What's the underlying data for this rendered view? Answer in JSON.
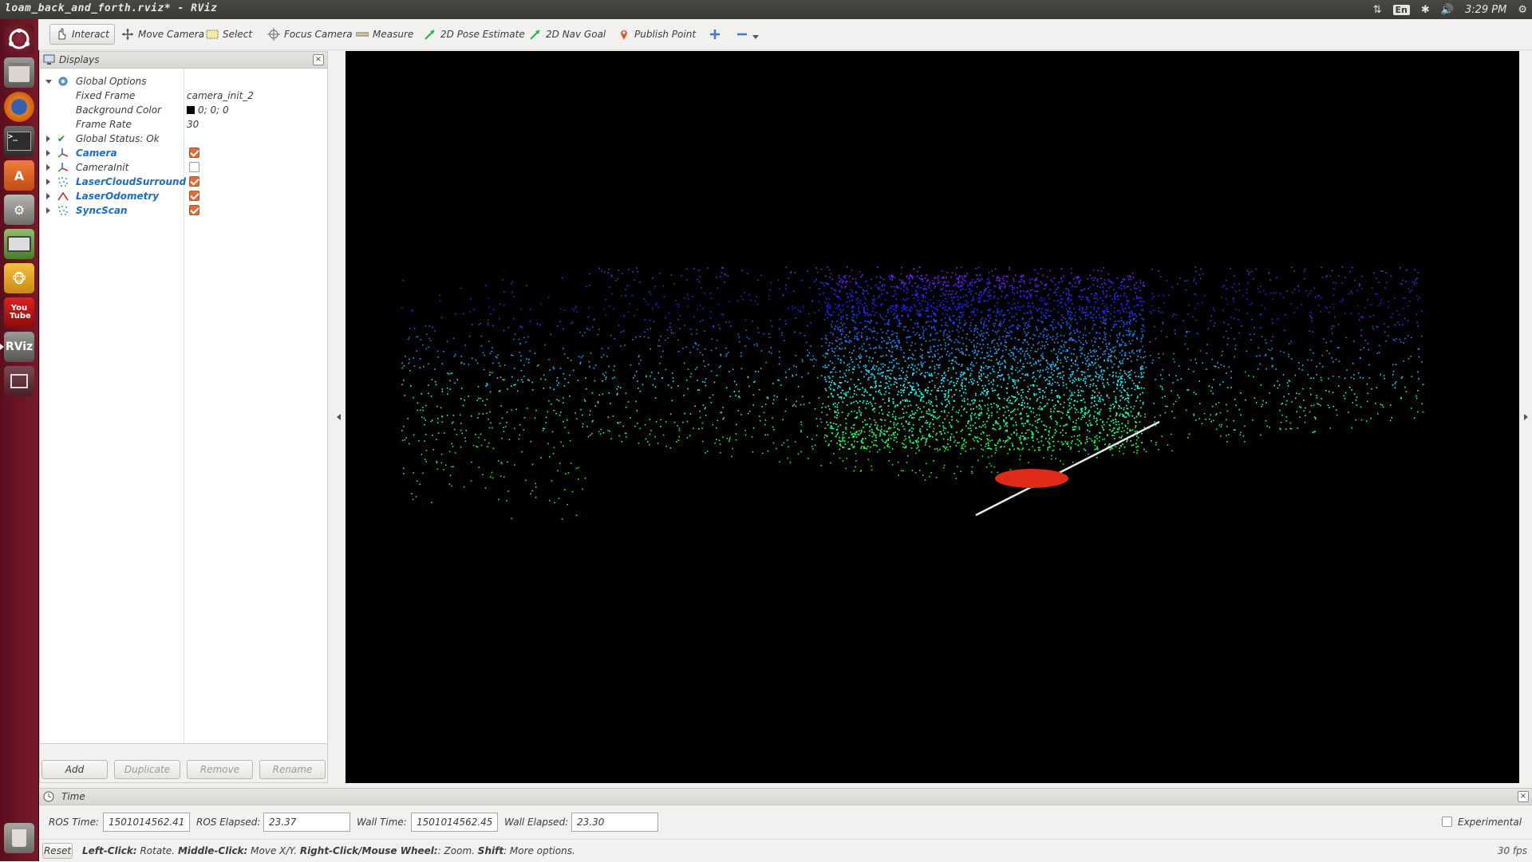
{
  "window": {
    "title": "loam_back_and_forth.rviz* - RViz"
  },
  "tray": {
    "language": "En",
    "clock": "3:29 PM"
  },
  "launcher": {
    "rviz_label": "RViz",
    "youtube_label": "You Tube"
  },
  "toolbar": {
    "interact": "Interact",
    "move_camera": "Move Camera",
    "select": "Select",
    "focus_camera": "Focus Camera",
    "measure": "Measure",
    "pose_estimate": "2D Pose Estimate",
    "nav_goal": "2D Nav Goal",
    "publish_point": "Publish Point"
  },
  "displays": {
    "title": "Displays",
    "global_options": "Global Options",
    "fixed_frame_label": "Fixed Frame",
    "fixed_frame_value": "camera_init_2",
    "background_color_label": "Background Color",
    "background_color_value": "0; 0; 0",
    "frame_rate_label": "Frame Rate",
    "frame_rate_value": "30",
    "global_status": "Global Status: Ok",
    "items": [
      {
        "label": "Camera",
        "checked": true
      },
      {
        "label": "CameraInit",
        "checked": false
      },
      {
        "label": "LaserCloudSurround",
        "checked": true
      },
      {
        "label": "LaserOdometry",
        "checked": true
      },
      {
        "label": "SyncScan",
        "checked": true
      }
    ],
    "buttons": {
      "add": "Add",
      "duplicate": "Duplicate",
      "remove": "Remove",
      "rename": "Rename"
    }
  },
  "time": {
    "title": "Time",
    "ros_time_label": "ROS Time:",
    "ros_time_value": "1501014562.41",
    "ros_elapsed_label": "ROS Elapsed:",
    "ros_elapsed_value": "23.37",
    "wall_time_label": "Wall Time:",
    "wall_time_value": "1501014562.45",
    "wall_elapsed_label": "Wall Elapsed:",
    "wall_elapsed_value": "23.30",
    "experimental": "Experimental"
  },
  "status": {
    "reset": "Reset",
    "hint_left_click": "Left-Click:",
    "hint_rotate": " Rotate. ",
    "hint_middle_click": "Middle-Click:",
    "hint_move": " Move X/Y. ",
    "hint_right_click": "Right-Click/Mouse Wheel:",
    "hint_zoom": ": Zoom. ",
    "hint_shift": "Shift",
    "hint_more": ": More options.",
    "fps": "30 fps"
  },
  "colors": {
    "accent_checkbox": "#e86a2e",
    "display_label_blue": "#1a6ec8",
    "launcher": "#6b1424",
    "view_background": "#000000"
  }
}
